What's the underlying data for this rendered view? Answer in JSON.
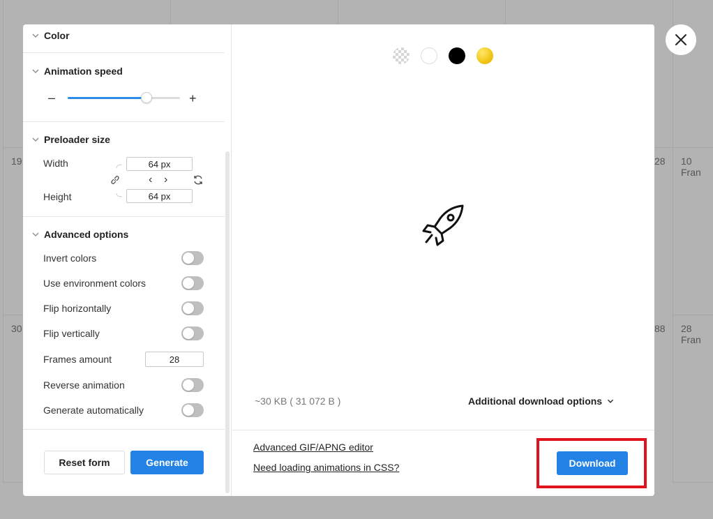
{
  "background": {
    "left_labels": [
      "19",
      "30"
    ],
    "right_numbers": [
      "28",
      "88"
    ],
    "right_labels": [
      "10 Fran",
      "28 Fran"
    ]
  },
  "colors": {
    "accent": "#2282e6",
    "highlight": "#e0141e",
    "swatch_yellow": "#f2c81c"
  },
  "sections": {
    "color": "Color",
    "animation_speed": "Animation speed",
    "preloader_size": "Preloader size",
    "advanced_options": "Advanced options"
  },
  "speed": {
    "minus": "–",
    "plus": "+",
    "value_fraction": 0.7
  },
  "preloader": {
    "width_label": "Width",
    "width_value": "64 px",
    "height_label": "Height",
    "height_value": "64 px",
    "prev": "‹",
    "next": "›"
  },
  "advanced": {
    "invert_colors": "Invert colors",
    "use_env_colors": "Use environment colors",
    "flip_h": "Flip horizontally",
    "flip_v": "Flip vertically",
    "frames_label": "Frames amount",
    "frames_value": "28",
    "reverse": "Reverse animation",
    "generate_auto": "Generate automatically"
  },
  "buttons": {
    "reset": "Reset form",
    "generate": "Generate",
    "download": "Download"
  },
  "preview": {
    "size": "~30 KB ( 31 072 B )",
    "more_options": "Additional download options"
  },
  "links": {
    "gif_editor": "Advanced GIF/APNG editor",
    "css_loaders": "Need loading animations in CSS?"
  }
}
